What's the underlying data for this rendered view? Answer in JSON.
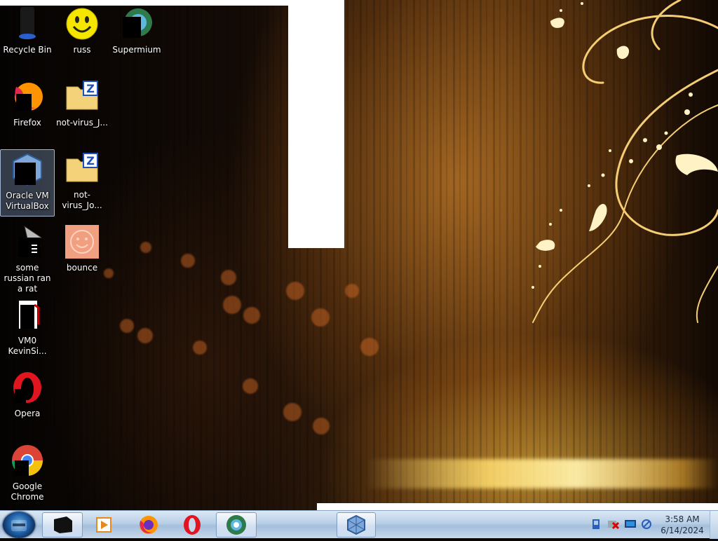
{
  "desktop": {
    "icons": [
      {
        "label": "Recycle Bin",
        "icon": "recycle-bin-icon"
      },
      {
        "label": "russ",
        "icon": "smiley-icon"
      },
      {
        "label": "Supermium",
        "icon": "supermium-icon"
      },
      {
        "label": "Firefox",
        "icon": "firefox-icon"
      },
      {
        "label": "not-virus_J...",
        "icon": "zip-folder-icon"
      },
      {
        "label": "Oracle VM VirtualBox",
        "icon": "virtualbox-icon"
      },
      {
        "label": "not-virus_Jo...",
        "icon": "zip-folder-icon"
      },
      {
        "label": "some russian ran a rat",
        "icon": "shortcut-app-icon"
      },
      {
        "label": "bounce",
        "icon": "bounce-icon"
      },
      {
        "label": "VM0 KevinSi...",
        "icon": "document-shortcut-icon"
      },
      {
        "label": "Opera",
        "icon": "opera-icon"
      },
      {
        "label": "Google Chrome",
        "icon": "chrome-icon"
      }
    ]
  },
  "taskbar": {
    "start_icon": "windows-start-icon",
    "pinned": [
      {
        "name": "black-window-app",
        "icon": "black-window-icon"
      },
      {
        "name": "media-player",
        "icon": "media-player-icon"
      },
      {
        "name": "firefox",
        "icon": "firefox-icon"
      },
      {
        "name": "opera",
        "icon": "opera-icon"
      },
      {
        "name": "supermium",
        "icon": "supermium-icon"
      },
      {
        "name": "virtualbox",
        "icon": "virtualbox-icon"
      }
    ],
    "tray": [
      "network-icon",
      "volume-muted-icon",
      "display-icon",
      "connection-icon"
    ],
    "clock": {
      "time": "3:58 AM",
      "date": "6/14/2024"
    }
  },
  "colors": {
    "taskbar": "#b9cfe6",
    "wallpaper_glow": "#ffc84a",
    "selection": "#8caad2"
  }
}
